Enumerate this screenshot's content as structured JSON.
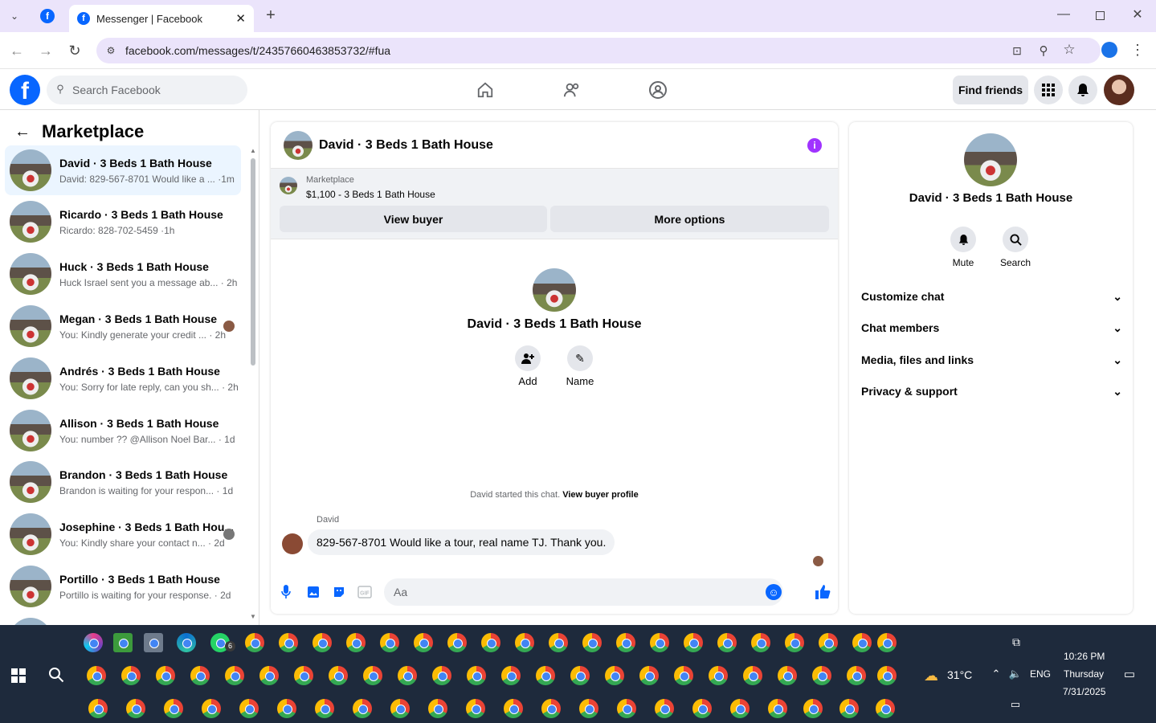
{
  "browser": {
    "tab_title": "Messenger | Facebook",
    "url": "facebook.com/messages/t/24357660463853732/#fua"
  },
  "header": {
    "search_placeholder": "Search Facebook",
    "find_friends": "Find friends"
  },
  "left": {
    "title": "Marketplace",
    "conversations": [
      {
        "name": "David · 3 Beds 1 Bath House",
        "preview": "David: 829-567-8701 Would like a ... ·1m"
      },
      {
        "name": "Ricardo · 3 Beds 1 Bath House",
        "preview": "Ricardo: 828-702-5459 ·1h"
      },
      {
        "name": "Huck · 3 Beds 1 Bath House",
        "preview": "Huck Israel sent you a message ab... · 2h"
      },
      {
        "name": "Megan · 3 Beds 1 Bath House",
        "preview": "You: Kindly generate your credit ... · 2h"
      },
      {
        "name": "Andrés · 3 Beds 1 Bath House",
        "preview": "You: Sorry for late reply, can you sh... · 2h"
      },
      {
        "name": "Allison · 3 Beds 1 Bath House",
        "preview": "You: number ?? @Allison Noel Bar... · 1d"
      },
      {
        "name": "Brandon · 3 Beds 1 Bath House",
        "preview": "Brandon is waiting for your respon... · 1d"
      },
      {
        "name": "Josephine · 3 Beds 1 Bath Hou...",
        "preview": "You: Kindly share your contact n... · 2d"
      },
      {
        "name": "Portillo · 3 Beds 1 Bath House",
        "preview": "Portillo is waiting for your response. · 2d"
      }
    ]
  },
  "chat": {
    "title": "David · 3 Beds 1 Bath House",
    "marketplace_label": "Marketplace",
    "listing": "$1,100 - 3 Beds 1 Bath House",
    "view_buyer": "View buyer",
    "more_options": "More options",
    "profile_name": "David · 3 Beds 1 Bath House",
    "add_label": "Add",
    "name_label": "Name",
    "started_text": "David started this chat.",
    "view_buyer_profile": "View buyer profile",
    "sender": "David",
    "message": "829-567-8701 Would like a tour, real name TJ. Thank you.",
    "input_placeholder": "Aa"
  },
  "details": {
    "name": "David · 3 Beds 1 Bath House",
    "mute": "Mute",
    "search": "Search",
    "sections": [
      "Customize chat",
      "Chat members",
      "Media, files and links",
      "Privacy & support"
    ]
  },
  "taskbar": {
    "temperature": "31°C",
    "language": "ENG",
    "time": "10:26 PM",
    "day": "Thursday",
    "date": "7/31/2025",
    "whatsapp_badge": "6"
  }
}
